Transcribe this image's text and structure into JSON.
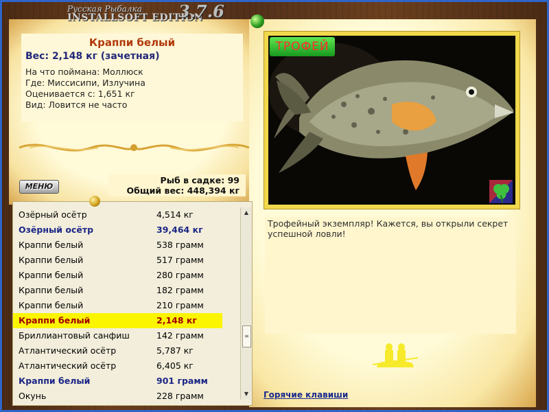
{
  "brand": {
    "subtitle": "Русская Рыбалка",
    "title": "INSTALLSOFT EDITION",
    "version": "3.7.6"
  },
  "catch": {
    "name": "Краппи белый",
    "weight": "Вес: 2,148 кг (зачетная)",
    "bait": "На что поймана: Моллюск",
    "location": "Где: Миссисипи, Излучина",
    "valued": "Оценивается с: 1,651 кг",
    "rarity": "Вид: Ловится не часто"
  },
  "menu_label": "МЕНЮ",
  "summary": {
    "count": "Рыб в садке: 99",
    "total": "Общий вес: 448,394 кг"
  },
  "list": [
    {
      "name": "Озёрный осётр",
      "weight": "4,514 кг",
      "style": "normal"
    },
    {
      "name": "Озёрный осётр",
      "weight": "39,464 кг",
      "style": "bold"
    },
    {
      "name": "Краппи белый",
      "weight": "538 грамм",
      "style": "normal"
    },
    {
      "name": "Краппи белый",
      "weight": "517 грамм",
      "style": "normal"
    },
    {
      "name": "Краппи белый",
      "weight": "280 грамм",
      "style": "normal"
    },
    {
      "name": "Краппи белый",
      "weight": "182 грамм",
      "style": "normal"
    },
    {
      "name": "Краппи белый",
      "weight": "210 грамм",
      "style": "normal"
    },
    {
      "name": "Краппи белый",
      "weight": "2,148 кг",
      "style": "selected"
    },
    {
      "name": "Бриллиантовый санфиш",
      "weight": "142 грамм",
      "style": "normal"
    },
    {
      "name": "Атлантический осётр",
      "weight": "5,787 кг",
      "style": "normal"
    },
    {
      "name": "Атлантический осётр",
      "weight": "6,405 кг",
      "style": "normal"
    },
    {
      "name": "Краппи белый",
      "weight": "901 грамм",
      "style": "bold"
    },
    {
      "name": "Окунь",
      "weight": "228 грамм",
      "style": "normal"
    }
  ],
  "photo": {
    "trophy_label": "ТРОФЕЙ"
  },
  "description": "Трофейный экземпляр! Кажется, вы открыли секрет успешной ловли!",
  "hotkeys_label": "Горячие клавиши",
  "colors": {
    "frame_blue": "#2f64c8",
    "selection": "#fcf500",
    "name_accent": "#b23a0d",
    "weight_accent": "#22287a"
  }
}
